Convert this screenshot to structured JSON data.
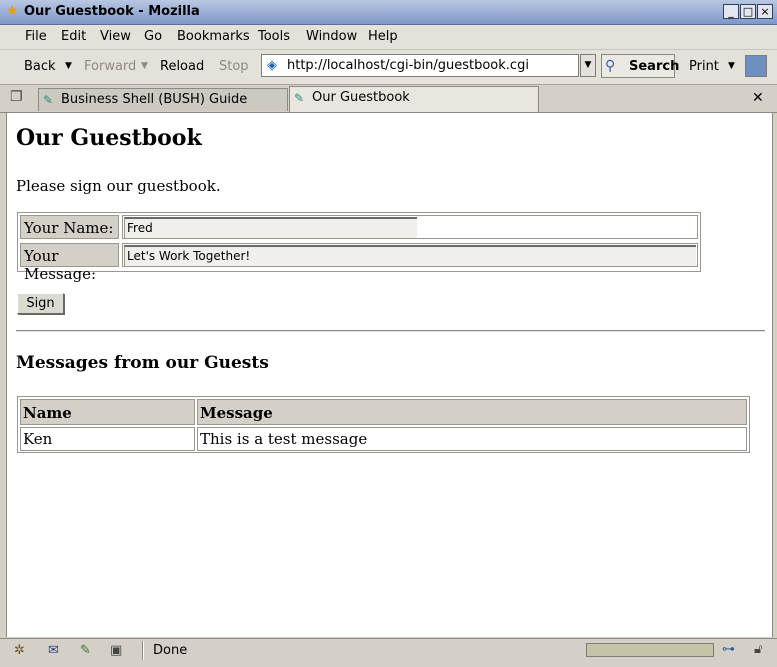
{
  "window": {
    "title": "Our Guestbook - Mozilla",
    "controls": [
      "_",
      "□",
      "×"
    ]
  },
  "menu": [
    "File",
    "Edit",
    "View",
    "Go",
    "Bookmarks",
    "Tools",
    "Window",
    "Help"
  ],
  "nav": {
    "back": "Back",
    "forward": "Forward",
    "reload": "Reload",
    "stop": "Stop",
    "url": "http://localhost/cgi-bin/guestbook.cgi",
    "search": "Search",
    "print": "Print"
  },
  "tabs": [
    {
      "label": "Business Shell (BUSH) Guide",
      "active": false
    },
    {
      "label": "Our Guestbook",
      "active": true
    }
  ],
  "page": {
    "heading": "Our Guestbook",
    "intro": "Please sign our guestbook.",
    "form": {
      "name_label": "Your Name:",
      "name_value": "Fred",
      "message_label": "Your Message:",
      "message_value": "Let's Work Together!",
      "submit_label": "Sign"
    },
    "messages_heading": "Messages from our Guests",
    "messages_table": {
      "headers": [
        "Name",
        "Message"
      ],
      "rows": [
        [
          "Ken",
          "This is a test message"
        ]
      ]
    }
  },
  "status": {
    "text": "Done"
  },
  "icons": {
    "title": "mozilla-star-icon",
    "url": "page-proxy-icon",
    "search": "search-glass-icon",
    "tab": "bookmark-pen-icon",
    "online": "online-plug-icon",
    "security": "padlock-icon"
  }
}
